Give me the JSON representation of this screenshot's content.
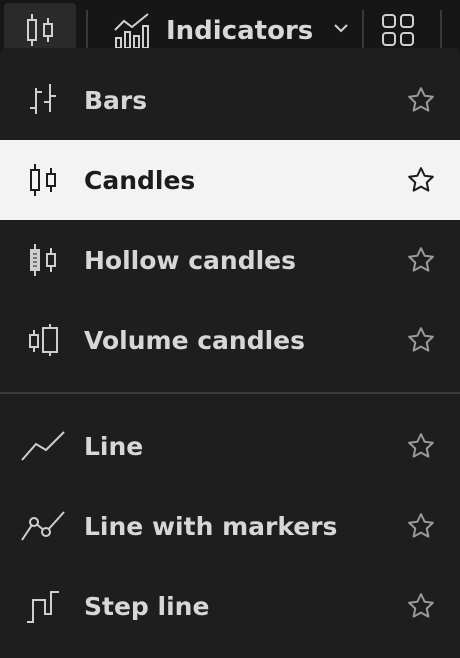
{
  "toolbar": {
    "chart_type_icon": "candles-icon",
    "indicators_label": "Indicators",
    "indicators_icon": "indicators-icon",
    "dropdown_icon": "chevron-down-icon",
    "layout_icon": "grid-layout-icon"
  },
  "menu": {
    "items": [
      {
        "label": "Bars",
        "icon": "bars-icon",
        "selected": false
      },
      {
        "label": "Candles",
        "icon": "candles-icon",
        "selected": true
      },
      {
        "label": "Hollow candles",
        "icon": "hollow-candles-icon",
        "selected": false
      },
      {
        "label": "Volume candles",
        "icon": "volume-candles-icon",
        "selected": false
      },
      {
        "label": "Line",
        "icon": "line-icon",
        "selected": false
      },
      {
        "label": "Line with markers",
        "icon": "line-markers-icon",
        "selected": false
      },
      {
        "label": "Step line",
        "icon": "step-line-icon",
        "selected": false
      }
    ],
    "favorite_icon": "star-outline-icon"
  },
  "colors": {
    "background": "#1e1e1e",
    "selected_background": "#f3f3f3",
    "text": "#d7d7d7",
    "selected_text": "#1c1c1c"
  }
}
